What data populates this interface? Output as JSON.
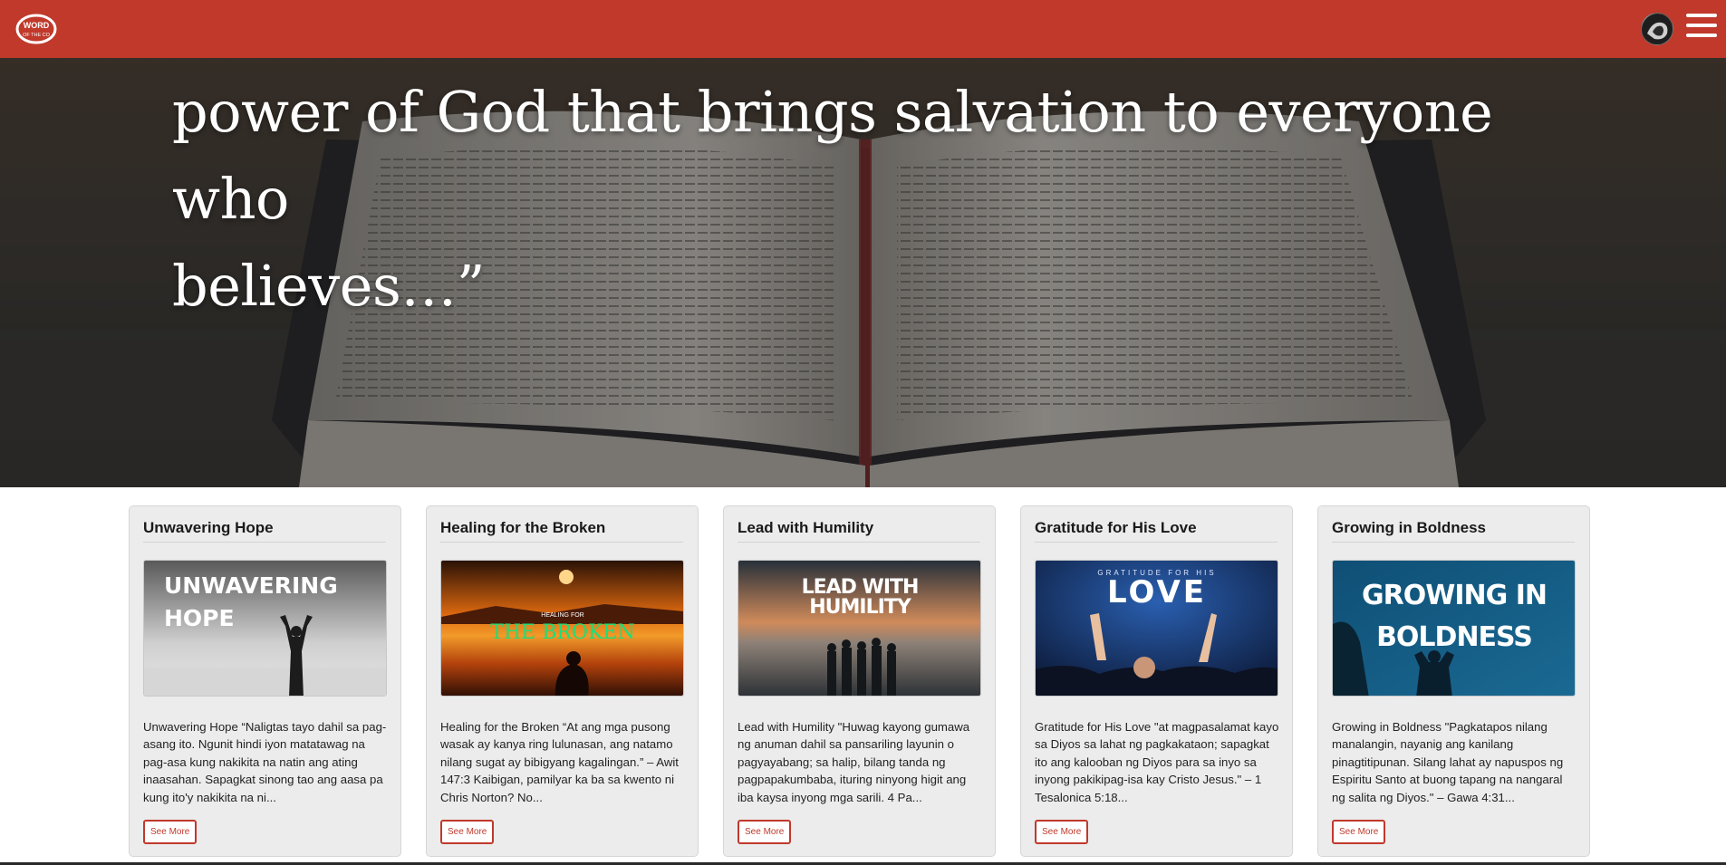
{
  "header": {
    "logo_text": "WORD OF THE CO",
    "brand_color": "#c0392b",
    "avatar_icon": "profile-avatar",
    "menu_icon": "hamburger-menu-icon"
  },
  "hero": {
    "quote_line1": "power of God that brings salvation to everyone who",
    "quote_line2": "believes…”"
  },
  "cards": [
    {
      "title": "Unwavering Hope",
      "image_text_1": "UNWAVERING",
      "image_text_2": "HOPE",
      "excerpt": "Unwavering Hope “Naligtas tayo dahil sa pag-asang ito. Ngunit hindi iyon matatawag na pag-asa kung nakikita na natin ang ating inaasahan. Sapagkat sinong tao ang aasa pa kung ito'y nakikita na ni...",
      "button": "See More"
    },
    {
      "title": "Healing for the Broken",
      "image_text_1": "HEALING FOR",
      "image_text_2": "THE BROKEN",
      "excerpt": "Healing for the Broken “At ang mga pusong wasak ay kanya ring lulunasan, ang natamo nilang sugat ay bibigyang kagalingan.” – Awit 147:3 Kaibigan, pamilyar ka ba sa kwento ni Chris Norton? No...",
      "button": "See More"
    },
    {
      "title": "Lead with Humility",
      "image_text_1": "LEAD WITH",
      "image_text_2": "HUMILITY",
      "excerpt": "Lead with Humility \"Huwag kayong gumawa ng anuman dahil sa pansariling layunin o pagyayabang; sa halip, bilang tanda ng pagpapakumbaba, ituring ninyong higit ang iba kaysa inyong mga sarili. 4 Pa...",
      "button": "See More"
    },
    {
      "title": "Gratitude for His Love",
      "image_text_1": "GRATITUDE FOR HIS",
      "image_text_2": "LOVE",
      "excerpt": "Gratitude for His Love \"at magpasalamat kayo sa Diyos sa lahat ng pagkakataon; sapagkat ito ang kalooban ng Diyos para sa inyo sa inyong pakikipag-isa kay Cristo Jesus.\" – 1 Tesalonica 5:18...",
      "button": "See More"
    },
    {
      "title": "Growing in Boldness",
      "image_text_1": "GROWING IN",
      "image_text_2": "BOLDNESS",
      "excerpt": "Growing in Boldness \"Pagkatapos nilang manalangin, nayanig ang kanilang pinagtitipunan. Silang lahat ay napuspos ng Espiritu Santo at buong tapang na nangaral ng salita ng Diyos.\" – Gawa 4:31...",
      "button": "See More"
    }
  ]
}
